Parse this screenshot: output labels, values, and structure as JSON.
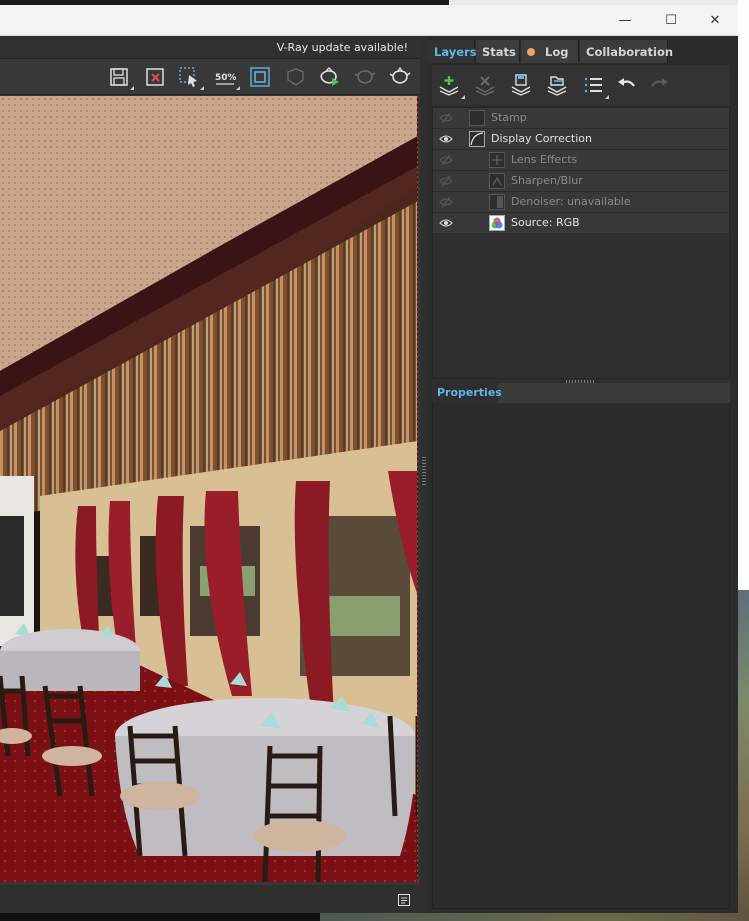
{
  "window": {
    "controls": {
      "minimize": "—",
      "maximize": "☐",
      "close": "✕"
    }
  },
  "banner": {
    "update_text": "V-Ray update available!"
  },
  "render_toolbar": {
    "tools": [
      {
        "name": "save-image-icon"
      },
      {
        "name": "clear-image-icon"
      },
      {
        "name": "region-select-icon"
      },
      {
        "name": "zoom-50-icon",
        "label": "50%"
      },
      {
        "name": "render-region-icon"
      },
      {
        "name": "lock-camera-icon"
      },
      {
        "name": "render-interactive-icon"
      },
      {
        "name": "render-teapot-icon"
      },
      {
        "name": "render-teapot-alt-icon"
      }
    ]
  },
  "tabs": {
    "layers": "Layers",
    "stats": "Stats",
    "log": "Log",
    "collaboration": "Collaboration",
    "active": "Layers",
    "log_dot_color": "#f0a068"
  },
  "layer_toolbar": {
    "tools": [
      "add-layer-icon",
      "remove-layer-icon",
      "save-layers-icon",
      "load-layers-icon",
      "layer-list-icon",
      "undo-icon",
      "redo-icon"
    ]
  },
  "layers": [
    {
      "name": "Stamp",
      "visible": false,
      "indent": 0,
      "icon": "stamp-icon"
    },
    {
      "name": "Display Correction",
      "visible": true,
      "indent": 0,
      "icon": "curve-icon"
    },
    {
      "name": "Lens Effects",
      "visible": false,
      "indent": 1,
      "icon": "lens-effects-icon"
    },
    {
      "name": "Sharpen/Blur",
      "visible": false,
      "indent": 1,
      "icon": "sharpen-icon"
    },
    {
      "name": "Denoiser: unavailable",
      "visible": false,
      "indent": 1,
      "icon": "denoiser-icon"
    },
    {
      "name": "Source: RGB",
      "visible": true,
      "indent": 1,
      "icon": "rgb-source-icon"
    }
  ],
  "properties": {
    "title": "Properties"
  },
  "colors": {
    "accent": "#5fb4e8",
    "panel": "#2c2c2c"
  }
}
